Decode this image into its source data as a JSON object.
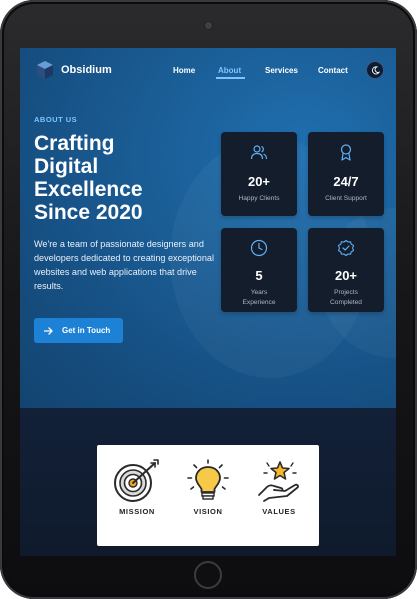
{
  "nav": {
    "brand": "Obsidium",
    "links": [
      "Home",
      "About",
      "Services",
      "Contact"
    ],
    "active": "About"
  },
  "hero": {
    "eyebrow": "ABOUT US",
    "headline": [
      "Crafting",
      "Digital",
      "Excellence",
      "Since 2020"
    ],
    "description": "We're a team of passionate designers and developers dedicated to creating exceptional websites and web applications that drive results.",
    "cta_label": "Get in Touch"
  },
  "stats": [
    {
      "icon": "users-icon",
      "value": "20+",
      "label": "Happy Clients"
    },
    {
      "icon": "award-icon",
      "value": "24/7",
      "label": "Client Support"
    },
    {
      "icon": "clock-icon",
      "value": "5",
      "label": [
        "Years",
        "Experience"
      ]
    },
    {
      "icon": "check-badge-icon",
      "value": "20+",
      "label": [
        "Projects",
        "Completed"
      ]
    }
  ],
  "values": [
    {
      "icon": "target-icon",
      "label": "MISSION"
    },
    {
      "icon": "lightbulb-icon",
      "label": "VISION"
    },
    {
      "icon": "hand-star-icon",
      "label": "VALUES"
    }
  ],
  "colors": {
    "accent": "#7fc3ff",
    "button": "#1d82d6",
    "card": "#141d2c",
    "hero_blue": "#1b5f98"
  }
}
